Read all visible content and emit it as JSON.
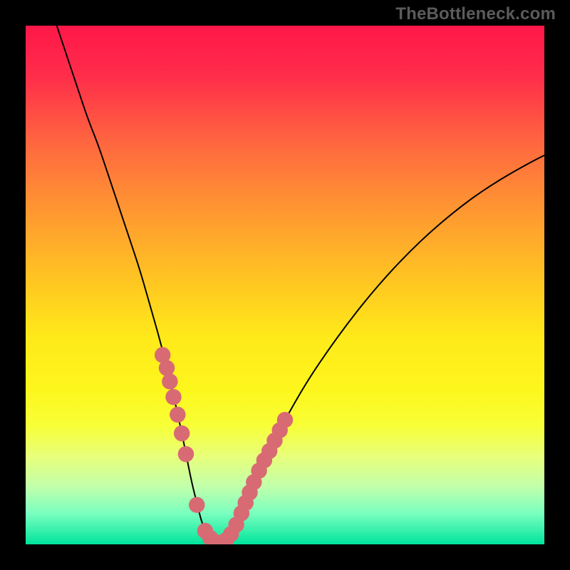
{
  "watermark": {
    "text": "TheBottleneck.com"
  },
  "chart_data": {
    "type": "line",
    "title": "",
    "xlabel": "",
    "ylabel": "",
    "xlim": [
      0,
      100
    ],
    "ylim": [
      0,
      100
    ],
    "grid": false,
    "legend": false,
    "series": [
      {
        "name": "bottleneck-curve",
        "x": [
          6,
          8,
          10,
          12,
          14,
          16,
          18,
          20,
          22,
          24,
          26,
          28,
          30,
          31,
          32,
          33,
          34,
          35,
          36,
          37,
          38,
          39,
          40,
          42,
          44,
          46,
          48,
          50,
          54,
          58,
          62,
          66,
          70,
          74,
          78,
          82,
          86,
          90,
          94,
          98,
          100
        ],
        "y": [
          100,
          94,
          88,
          82,
          77,
          71,
          65,
          59,
          53,
          46,
          39,
          31,
          22,
          17,
          12,
          8,
          4,
          2,
          0.6,
          0.2,
          0.4,
          1.4,
          3,
          7,
          11.5,
          16,
          20,
          24,
          31,
          37,
          42.5,
          47.6,
          52.2,
          56.4,
          60.2,
          63.6,
          66.7,
          69.4,
          71.8,
          74,
          75
        ]
      }
    ],
    "markers": [
      {
        "x": 26.4,
        "y": 36.5,
        "r": 1.2
      },
      {
        "x": 27.2,
        "y": 34.0,
        "r": 1.2
      },
      {
        "x": 27.8,
        "y": 31.4,
        "r": 1.2
      },
      {
        "x": 28.5,
        "y": 28.4,
        "r": 1.2
      },
      {
        "x": 29.3,
        "y": 25.0,
        "r": 1.2
      },
      {
        "x": 30.1,
        "y": 21.4,
        "r": 1.2
      },
      {
        "x": 30.9,
        "y": 17.4,
        "r": 1.2
      },
      {
        "x": 33.0,
        "y": 7.6,
        "r": 1.2
      },
      {
        "x": 34.6,
        "y": 2.6,
        "r": 1.2
      },
      {
        "x": 35.6,
        "y": 1.2,
        "r": 1.2
      },
      {
        "x": 36.6,
        "y": 0.4,
        "r": 1.2
      },
      {
        "x": 37.6,
        "y": 0.3,
        "r": 1.2
      },
      {
        "x": 38.6,
        "y": 0.8,
        "r": 1.2
      },
      {
        "x": 39.6,
        "y": 2.0,
        "r": 1.2
      },
      {
        "x": 40.6,
        "y": 3.8,
        "r": 1.2
      },
      {
        "x": 41.6,
        "y": 6.0,
        "r": 1.2
      },
      {
        "x": 42.4,
        "y": 8.0,
        "r": 1.2
      },
      {
        "x": 43.2,
        "y": 10.0,
        "r": 1.2
      },
      {
        "x": 44.0,
        "y": 12.0,
        "r": 1.2
      },
      {
        "x": 45.0,
        "y": 14.2,
        "r": 1.2
      },
      {
        "x": 46.0,
        "y": 16.2,
        "r": 1.2
      },
      {
        "x": 47.0,
        "y": 18.0,
        "r": 1.2
      },
      {
        "x": 48.0,
        "y": 20.0,
        "r": 1.2
      },
      {
        "x": 49.0,
        "y": 22.0,
        "r": 1.2
      },
      {
        "x": 50.0,
        "y": 24.0,
        "r": 1.2
      }
    ],
    "colors": {
      "curve": "#000000",
      "markers": "#d86a74",
      "background_gradient": [
        "#ff1749",
        "#ffe91a",
        "#00e49c"
      ]
    }
  }
}
